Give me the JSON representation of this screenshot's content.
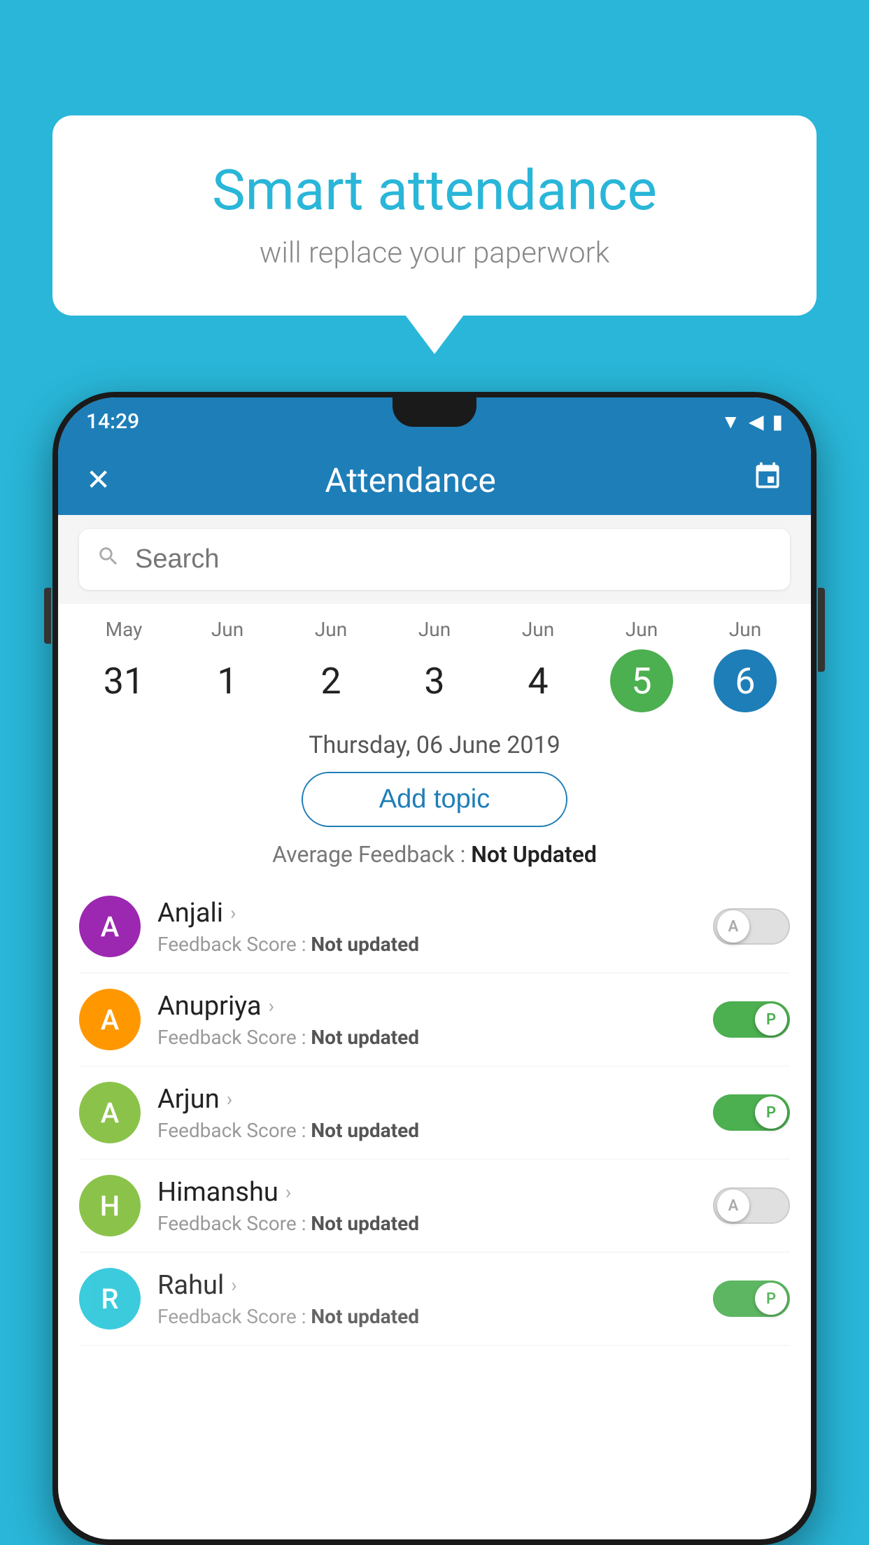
{
  "background_color": "#29b6d8",
  "bubble": {
    "title": "Smart attendance",
    "subtitle": "will replace your paperwork"
  },
  "status_bar": {
    "time": "14:29",
    "icons": [
      "wifi",
      "signal",
      "battery"
    ]
  },
  "app_bar": {
    "title": "Attendance",
    "close_icon": "✕",
    "calendar_icon": "📅"
  },
  "search": {
    "placeholder": "Search"
  },
  "calendar": {
    "days": [
      {
        "month": "May",
        "num": "31",
        "style": "normal"
      },
      {
        "month": "Jun",
        "num": "1",
        "style": "normal"
      },
      {
        "month": "Jun",
        "num": "2",
        "style": "normal"
      },
      {
        "month": "Jun",
        "num": "3",
        "style": "normal"
      },
      {
        "month": "Jun",
        "num": "4",
        "style": "normal"
      },
      {
        "month": "Jun",
        "num": "5",
        "style": "green"
      },
      {
        "month": "Jun",
        "num": "6",
        "style": "blue"
      }
    ]
  },
  "selected_date": "Thursday, 06 June 2019",
  "add_topic_label": "Add topic",
  "average_feedback": {
    "label": "Average Feedback :",
    "value": "Not Updated"
  },
  "students": [
    {
      "name": "Anjali",
      "avatar_letter": "A",
      "avatar_color": "#9c27b0",
      "feedback_label": "Feedback Score :",
      "feedback_value": "Not updated",
      "toggle_state": "off",
      "toggle_letter": "A"
    },
    {
      "name": "Anupriya",
      "avatar_letter": "A",
      "avatar_color": "#ff9800",
      "feedback_label": "Feedback Score :",
      "feedback_value": "Not updated",
      "toggle_state": "on",
      "toggle_letter": "P"
    },
    {
      "name": "Arjun",
      "avatar_letter": "A",
      "avatar_color": "#8bc34a",
      "feedback_label": "Feedback Score :",
      "feedback_value": "Not updated",
      "toggle_state": "on",
      "toggle_letter": "P"
    },
    {
      "name": "Himanshu",
      "avatar_letter": "H",
      "avatar_color": "#8bc34a",
      "feedback_label": "Feedback Score :",
      "feedback_value": "Not updated",
      "toggle_state": "off",
      "toggle_letter": "A"
    },
    {
      "name": "Rahul",
      "avatar_letter": "R",
      "avatar_color": "#26c6da",
      "feedback_label": "Feedback Score :",
      "feedback_value": "Not updated",
      "toggle_state": "on",
      "toggle_letter": "P"
    }
  ]
}
